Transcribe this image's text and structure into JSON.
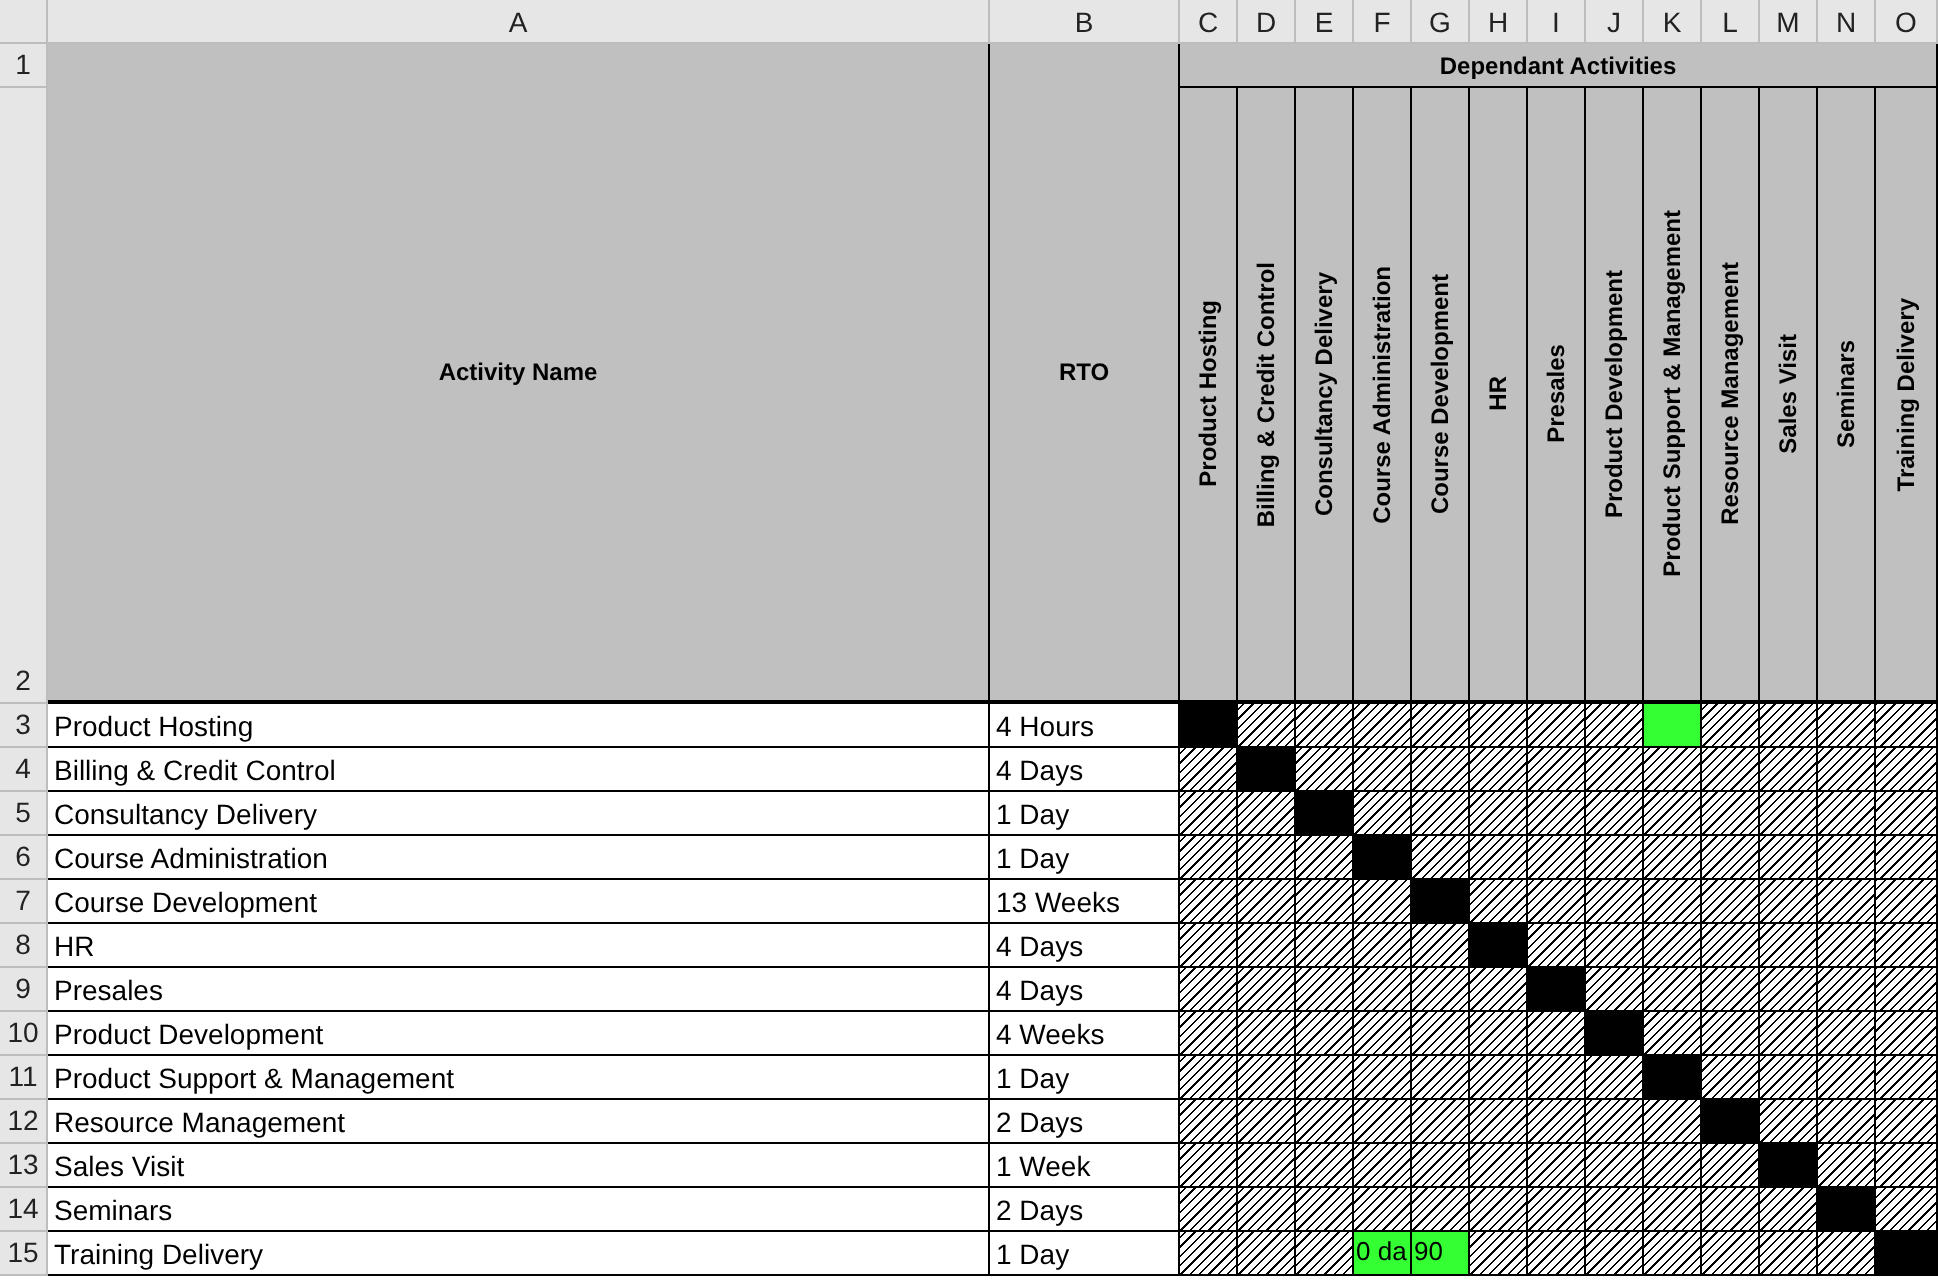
{
  "column_headers": [
    "A",
    "B",
    "C",
    "D",
    "E",
    "F",
    "G",
    "H",
    "I",
    "J",
    "K",
    "L",
    "M",
    "N",
    "O"
  ],
  "header": {
    "row_numbers": [
      "1",
      "2"
    ],
    "activity_heading": "Activity Name",
    "rto_heading": "RTO",
    "group_heading": "Dependant Activities",
    "dependants": [
      "Product Hosting",
      "Billing & Credit Control",
      "Consultancy Delivery",
      "Course Administration",
      "Course Development",
      "HR",
      "Presales",
      "Product Development",
      "Product Support & Management",
      "Resource Management",
      "Sales Visit",
      "Seminars",
      "Training Delivery"
    ]
  },
  "rows": [
    {
      "row_number": "3",
      "activity": "Product Hosting",
      "rto": "4 Hours",
      "cells": [
        {
          "kind": "self"
        },
        {
          "kind": "hatched"
        },
        {
          "kind": "hatched"
        },
        {
          "kind": "hatched"
        },
        {
          "kind": "hatched"
        },
        {
          "kind": "hatched"
        },
        {
          "kind": "hatched"
        },
        {
          "kind": "hatched"
        },
        {
          "kind": "dependant"
        },
        {
          "kind": "hatched"
        },
        {
          "kind": "hatched"
        },
        {
          "kind": "hatched"
        },
        {
          "kind": "hatched"
        }
      ]
    },
    {
      "row_number": "4",
      "activity": "Billing & Credit Control",
      "rto": "4 Days",
      "cells": [
        {
          "kind": "hatched"
        },
        {
          "kind": "self"
        },
        {
          "kind": "hatched"
        },
        {
          "kind": "hatched"
        },
        {
          "kind": "hatched"
        },
        {
          "kind": "hatched"
        },
        {
          "kind": "hatched"
        },
        {
          "kind": "hatched"
        },
        {
          "kind": "hatched"
        },
        {
          "kind": "hatched"
        },
        {
          "kind": "hatched"
        },
        {
          "kind": "hatched"
        },
        {
          "kind": "hatched"
        }
      ]
    },
    {
      "row_number": "5",
      "activity": "Consultancy Delivery",
      "rto": "1 Day",
      "cells": [
        {
          "kind": "hatched"
        },
        {
          "kind": "hatched"
        },
        {
          "kind": "self"
        },
        {
          "kind": "hatched"
        },
        {
          "kind": "hatched"
        },
        {
          "kind": "hatched"
        },
        {
          "kind": "hatched"
        },
        {
          "kind": "hatched"
        },
        {
          "kind": "hatched"
        },
        {
          "kind": "hatched"
        },
        {
          "kind": "hatched"
        },
        {
          "kind": "hatched"
        },
        {
          "kind": "hatched"
        }
      ]
    },
    {
      "row_number": "6",
      "activity": "Course Administration",
      "rto": "1 Day",
      "cells": [
        {
          "kind": "hatched"
        },
        {
          "kind": "hatched"
        },
        {
          "kind": "hatched"
        },
        {
          "kind": "self"
        },
        {
          "kind": "hatched"
        },
        {
          "kind": "hatched"
        },
        {
          "kind": "hatched"
        },
        {
          "kind": "hatched"
        },
        {
          "kind": "hatched"
        },
        {
          "kind": "hatched"
        },
        {
          "kind": "hatched"
        },
        {
          "kind": "hatched"
        },
        {
          "kind": "hatched"
        }
      ]
    },
    {
      "row_number": "7",
      "activity": "Course Development",
      "rto": "13 Weeks",
      "cells": [
        {
          "kind": "hatched"
        },
        {
          "kind": "hatched"
        },
        {
          "kind": "hatched"
        },
        {
          "kind": "hatched"
        },
        {
          "kind": "self"
        },
        {
          "kind": "hatched"
        },
        {
          "kind": "hatched"
        },
        {
          "kind": "hatched"
        },
        {
          "kind": "hatched"
        },
        {
          "kind": "hatched"
        },
        {
          "kind": "hatched"
        },
        {
          "kind": "hatched"
        },
        {
          "kind": "hatched"
        }
      ]
    },
    {
      "row_number": "8",
      "activity": "HR",
      "rto": "4 Days",
      "cells": [
        {
          "kind": "hatched"
        },
        {
          "kind": "hatched"
        },
        {
          "kind": "hatched"
        },
        {
          "kind": "hatched"
        },
        {
          "kind": "hatched"
        },
        {
          "kind": "self"
        },
        {
          "kind": "hatched"
        },
        {
          "kind": "hatched"
        },
        {
          "kind": "hatched"
        },
        {
          "kind": "hatched"
        },
        {
          "kind": "hatched"
        },
        {
          "kind": "hatched"
        },
        {
          "kind": "hatched"
        }
      ]
    },
    {
      "row_number": "9",
      "activity": "Presales",
      "rto": "4 Days",
      "cells": [
        {
          "kind": "hatched"
        },
        {
          "kind": "hatched"
        },
        {
          "kind": "hatched"
        },
        {
          "kind": "hatched"
        },
        {
          "kind": "hatched"
        },
        {
          "kind": "hatched"
        },
        {
          "kind": "self"
        },
        {
          "kind": "hatched"
        },
        {
          "kind": "hatched"
        },
        {
          "kind": "hatched"
        },
        {
          "kind": "hatched"
        },
        {
          "kind": "hatched"
        },
        {
          "kind": "hatched"
        }
      ]
    },
    {
      "row_number": "10",
      "activity": "Product Development",
      "rto": "4 Weeks",
      "cells": [
        {
          "kind": "hatched"
        },
        {
          "kind": "hatched"
        },
        {
          "kind": "hatched"
        },
        {
          "kind": "hatched"
        },
        {
          "kind": "hatched"
        },
        {
          "kind": "hatched"
        },
        {
          "kind": "hatched"
        },
        {
          "kind": "self"
        },
        {
          "kind": "hatched"
        },
        {
          "kind": "hatched"
        },
        {
          "kind": "hatched"
        },
        {
          "kind": "hatched"
        },
        {
          "kind": "hatched"
        }
      ]
    },
    {
      "row_number": "11",
      "activity": "Product Support & Management",
      "rto": "1 Day",
      "cells": [
        {
          "kind": "hatched"
        },
        {
          "kind": "hatched"
        },
        {
          "kind": "hatched"
        },
        {
          "kind": "hatched"
        },
        {
          "kind": "hatched"
        },
        {
          "kind": "hatched"
        },
        {
          "kind": "hatched"
        },
        {
          "kind": "hatched"
        },
        {
          "kind": "self"
        },
        {
          "kind": "hatched"
        },
        {
          "kind": "hatched"
        },
        {
          "kind": "hatched"
        },
        {
          "kind": "hatched"
        }
      ]
    },
    {
      "row_number": "12",
      "activity": "Resource Management",
      "rto": "2 Days",
      "cells": [
        {
          "kind": "hatched"
        },
        {
          "kind": "hatched"
        },
        {
          "kind": "hatched"
        },
        {
          "kind": "hatched"
        },
        {
          "kind": "hatched"
        },
        {
          "kind": "hatched"
        },
        {
          "kind": "hatched"
        },
        {
          "kind": "hatched"
        },
        {
          "kind": "hatched"
        },
        {
          "kind": "self"
        },
        {
          "kind": "hatched"
        },
        {
          "kind": "hatched"
        },
        {
          "kind": "hatched"
        }
      ]
    },
    {
      "row_number": "13",
      "activity": "Sales Visit",
      "rto": "1 Week",
      "cells": [
        {
          "kind": "hatched"
        },
        {
          "kind": "hatched"
        },
        {
          "kind": "hatched"
        },
        {
          "kind": "hatched"
        },
        {
          "kind": "hatched"
        },
        {
          "kind": "hatched"
        },
        {
          "kind": "hatched"
        },
        {
          "kind": "hatched"
        },
        {
          "kind": "hatched"
        },
        {
          "kind": "hatched"
        },
        {
          "kind": "self"
        },
        {
          "kind": "hatched"
        },
        {
          "kind": "hatched"
        }
      ]
    },
    {
      "row_number": "14",
      "activity": "Seminars",
      "rto": "2 Days",
      "cells": [
        {
          "kind": "hatched"
        },
        {
          "kind": "hatched"
        },
        {
          "kind": "hatched"
        },
        {
          "kind": "hatched"
        },
        {
          "kind": "hatched"
        },
        {
          "kind": "hatched"
        },
        {
          "kind": "hatched"
        },
        {
          "kind": "hatched"
        },
        {
          "kind": "hatched"
        },
        {
          "kind": "hatched"
        },
        {
          "kind": "hatched"
        },
        {
          "kind": "self"
        },
        {
          "kind": "hatched"
        }
      ]
    },
    {
      "row_number": "15",
      "activity": "Training Delivery",
      "rto": "1 Day",
      "cells": [
        {
          "kind": "hatched"
        },
        {
          "kind": "hatched"
        },
        {
          "kind": "hatched"
        },
        {
          "kind": "dependant",
          "text": "0 da"
        },
        {
          "kind": "dependant",
          "text": "90"
        },
        {
          "kind": "hatched"
        },
        {
          "kind": "hatched"
        },
        {
          "kind": "hatched"
        },
        {
          "kind": "hatched"
        },
        {
          "kind": "hatched"
        },
        {
          "kind": "hatched"
        },
        {
          "kind": "hatched"
        },
        {
          "kind": "self"
        }
      ]
    }
  ]
}
